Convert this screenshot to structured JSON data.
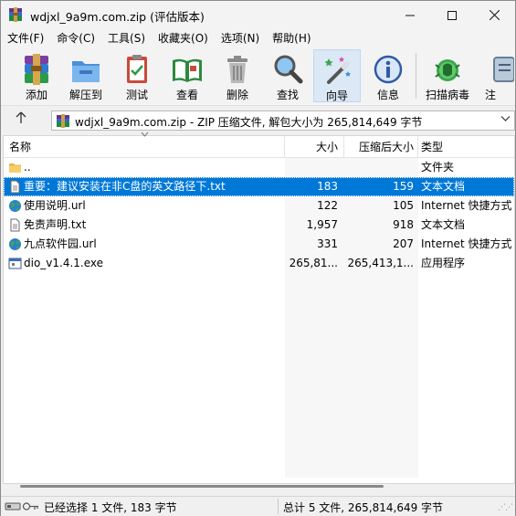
{
  "window": {
    "title": "wdjxl_9a9m.com.zip (评估版本)",
    "minimize_icon": "minimize-icon",
    "maximize_icon": "maximize-icon",
    "close_icon": "close-icon"
  },
  "menu": [
    "文件(F)",
    "命令(C)",
    "工具(S)",
    "收藏夹(O)",
    "选项(N)",
    "帮助(H)"
  ],
  "toolbar": {
    "add": "添加",
    "extract": "解压到",
    "test": "测试",
    "view": "查看",
    "delete": "删除",
    "find": "查找",
    "wizard": "向导",
    "info": "信息",
    "virus_scan": "扫描病毒",
    "comment": "注"
  },
  "address": {
    "path": "wdjxl_9a9m.com.zip - ZIP 压缩文件, 解包大小为 265,814,649 字节",
    "up_icon": "up-arrow-icon",
    "dropdown_icon": "chevron-down-icon"
  },
  "columns": {
    "name": "名称",
    "size": "大小",
    "packed": "压缩后大小",
    "type": "类型"
  },
  "files": [
    {
      "name": "..",
      "size": "",
      "packed": "",
      "type": "文件夹",
      "icon": "folder-icon"
    },
    {
      "name": "重要：建议安装在非C盘的英文路径下.txt",
      "size": "183",
      "packed": "159",
      "type": "文本文档",
      "icon": "text-file-icon"
    },
    {
      "name": "使用说明.url",
      "size": "122",
      "packed": "105",
      "type": "Internet 快捷方式",
      "icon": "globe-icon"
    },
    {
      "name": "免责声明.txt",
      "size": "1,957",
      "packed": "918",
      "type": "文本文档",
      "icon": "text-file-icon"
    },
    {
      "name": "九点软件园.url",
      "size": "331",
      "packed": "207",
      "type": "Internet 快捷方式",
      "icon": "globe-icon"
    },
    {
      "name": "dio_v1.4.1.exe",
      "size": "265,81...",
      "packed": "265,413,1...",
      "type": "应用程序",
      "icon": "exe-icon"
    }
  ],
  "selected_row": 1,
  "status": {
    "left": "已经选择 1 文件, 183 字节",
    "right": "总计 5 文件, 265,814,649 字节"
  },
  "colors": {
    "selection": "#0078d7",
    "window_bg": "#f0f0f0"
  }
}
